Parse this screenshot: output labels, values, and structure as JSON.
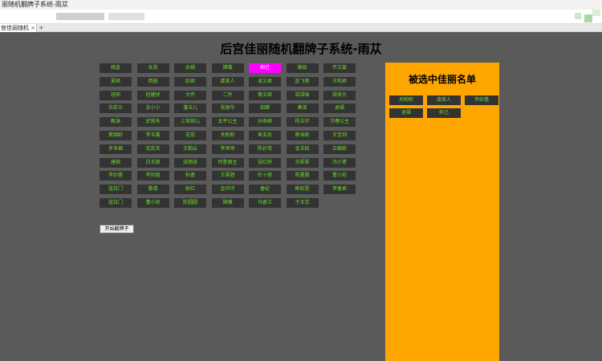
{
  "browser": {
    "window_title": "丽随机翻牌子系统-雨苁",
    "tab_title": "宫佳丽随机",
    "tab_close": "×",
    "new_tab": "+"
  },
  "page": {
    "title": "后宫佳丽随机翻牌子系统-雨苁"
  },
  "names": [
    "嫣皇",
    "女英",
    "女娲",
    "嫦娥",
    "妲己",
    "褒姒",
    "齐文姜",
    "夏姬",
    "西施",
    "赵姬",
    "虞美人",
    "卓文君",
    "赵飞燕",
    "王昭君",
    "班昭",
    "班婕妤",
    "大乔",
    "二乔",
    "蔡文姬",
    "梁绿珠",
    "绿美台",
    "苏若兰",
    "苏小小",
    "潘玉儿",
    "张丽华",
    "貂蝉",
    "萧淑",
    "退福",
    "甄洛",
    "武则天",
    "上官婉儿",
    "太平公主",
    "孙寿娘",
    "杨玉环",
    "万春公主",
    "樊嫣龄",
    "李玉娥",
    "花蕊",
    "关盼盼",
    "鱼玄机",
    "薛涛龄",
    "王宝钏",
    "步非烟",
    "花蕊夫",
    "王朝云",
    "李师师",
    "陈妙常",
    "金玉奴",
    "吕翰妮",
    "唐婉",
    "白玉娘",
    "张丽容",
    "阿鲁图主",
    "张红桥",
    "刘翠翠",
    "冯小青",
    "李妙惠",
    "李凤姐",
    "秋香",
    "王翠翘",
    "杜十娘",
    "陈圆圆",
    "董小宛",
    "寇白门",
    "慈禧",
    "秋红",
    "金环环",
    "香妃",
    "柳如是",
    "李香君",
    "寇白门",
    "董小宛",
    "陈圆圆",
    "顾横",
    "马香兰",
    "卞玉京"
  ],
  "active_index": 4,
  "panel": {
    "title": "被选中佳丽名单",
    "selected": [
      "关盼盼",
      "虞美人",
      "李妙惠",
      "退福",
      "妲己"
    ]
  },
  "controls": {
    "start_label": "开始翻牌子"
  },
  "colors": {
    "page_bg": "#5a5a5a",
    "button_bg": "#333333",
    "button_text": "#6cdd2a",
    "active_bg": "#ff00ff",
    "panel_bg": "#ffa500"
  }
}
